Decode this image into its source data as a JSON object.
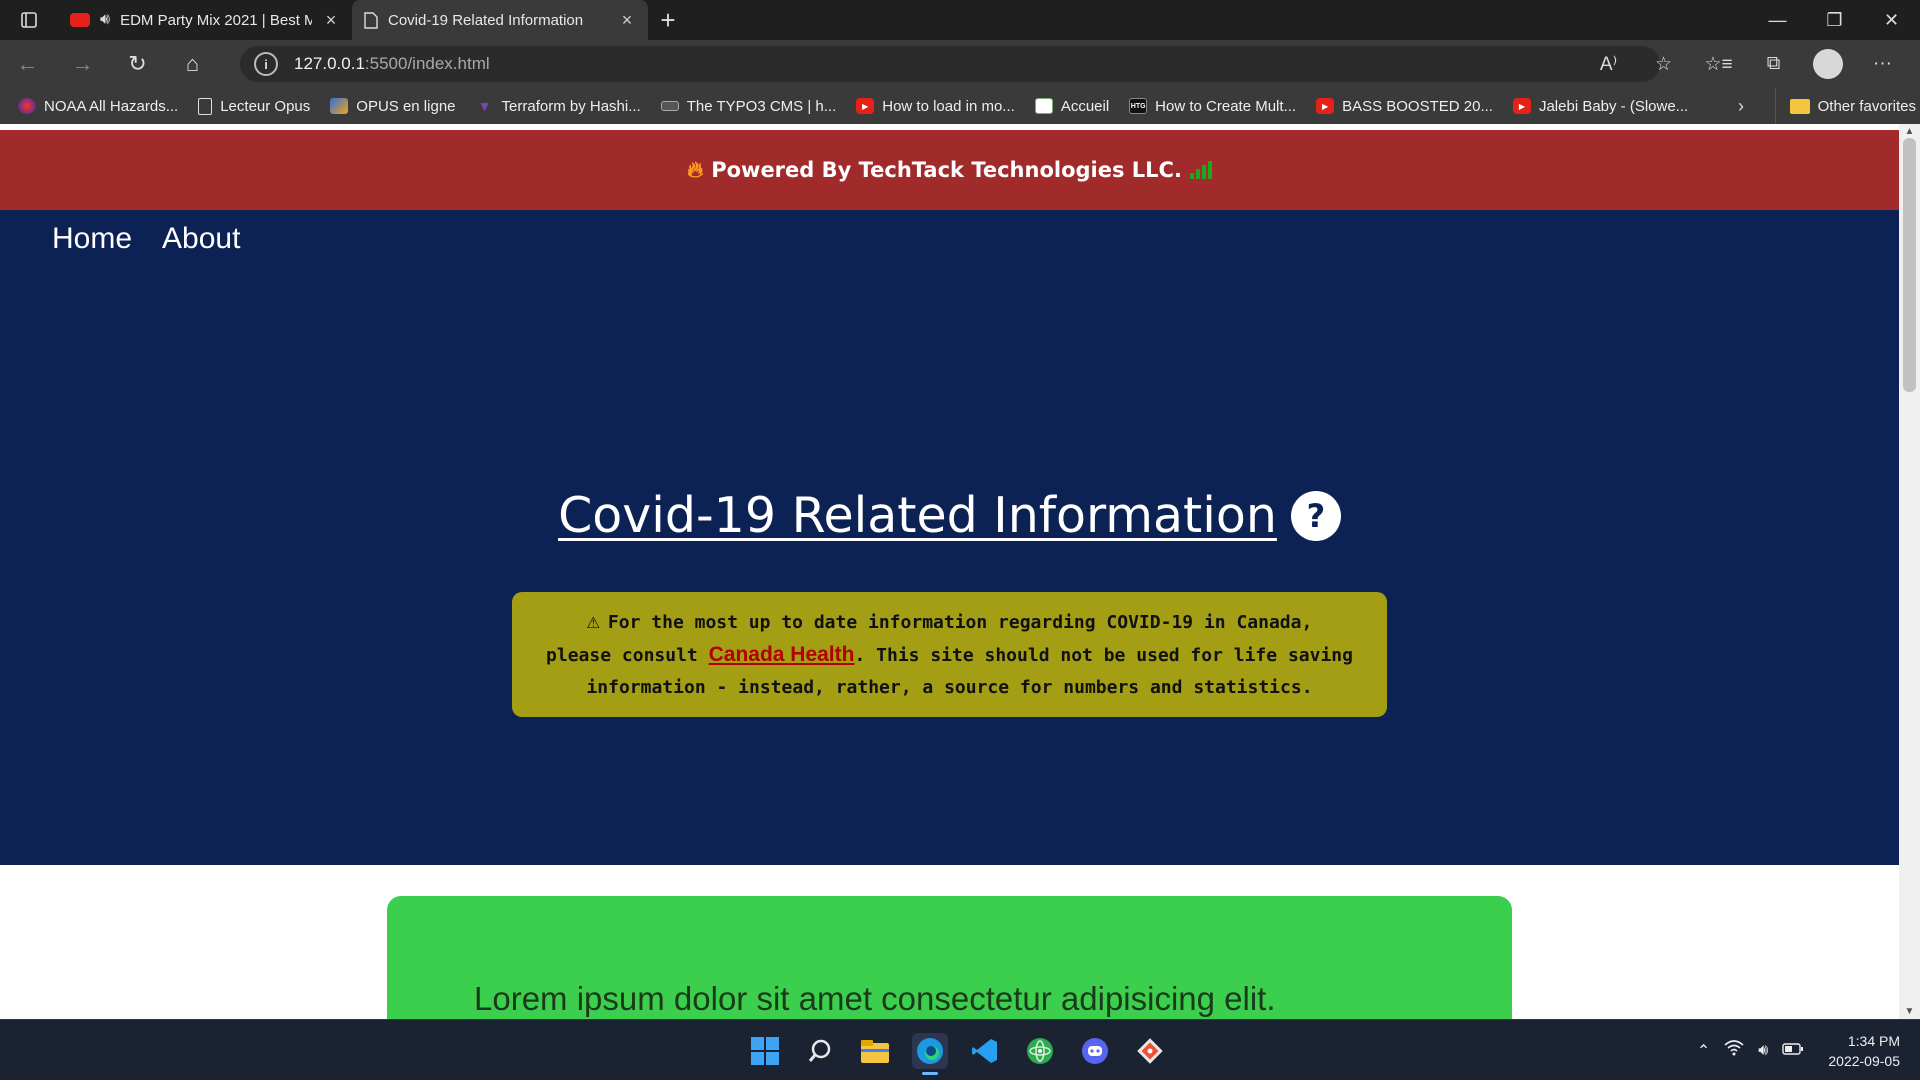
{
  "tabs": [
    {
      "title": "EDM Party Mix 2021 | Best M",
      "active": false
    },
    {
      "title": "Covid-19 Related Information",
      "active": true
    }
  ],
  "address": {
    "host": "127.0.0.1",
    "path": ":5500/index.html"
  },
  "favorites": [
    {
      "label": "NOAA All Hazards...",
      "icon": "noaa-icon"
    },
    {
      "label": "Lecteur Opus",
      "icon": "page-icon"
    },
    {
      "label": "OPUS en ligne",
      "icon": "opus-icon"
    },
    {
      "label": "Terraform by Hashi...",
      "icon": "terraform-icon"
    },
    {
      "label": "The TYPO3 CMS | h...",
      "icon": "typo3-icon"
    },
    {
      "label": "How to load in mo...",
      "icon": "youtube-icon"
    },
    {
      "label": "Accueil",
      "icon": "accueil-icon"
    },
    {
      "label": "How to Create Mult...",
      "icon": "htg-icon"
    },
    {
      "label": "BASS BOOSTED 20...",
      "icon": "youtube-icon"
    },
    {
      "label": "Jalebi Baby - (Slowe...",
      "icon": "youtube-icon"
    }
  ],
  "favorites_other": "Other favorites",
  "page": {
    "banner": "Powered By TechTack Technologies LLC.",
    "nav": [
      "Home",
      "About"
    ],
    "headline": "Covid-19 Related Information",
    "help_glyph": "?",
    "notice": {
      "line1": "For the most up to date information regarding COVID-19 in Canada,",
      "line2_pre": "please consult ",
      "link": "Canada Health",
      "line2_post": ". This site should not be used for life saving",
      "line3": "information - instead, rather, a source for numbers and statistics."
    },
    "card_text": "Lorem ipsum dolor sit amet consectetur adipisicing elit."
  },
  "taskbar": {
    "apps": [
      "start-icon",
      "search-icon",
      "file-explorer-icon",
      "edge-icon",
      "vscode-icon",
      "atom-icon",
      "discord-icon",
      "git-icon"
    ],
    "time": "1:34 PM",
    "date": "2022-09-05"
  },
  "colors": {
    "banner": "#a12a2a",
    "hero": "#0c2255",
    "notice": "#a39e14",
    "card": "#3ccf4e",
    "link": "#b30000"
  }
}
